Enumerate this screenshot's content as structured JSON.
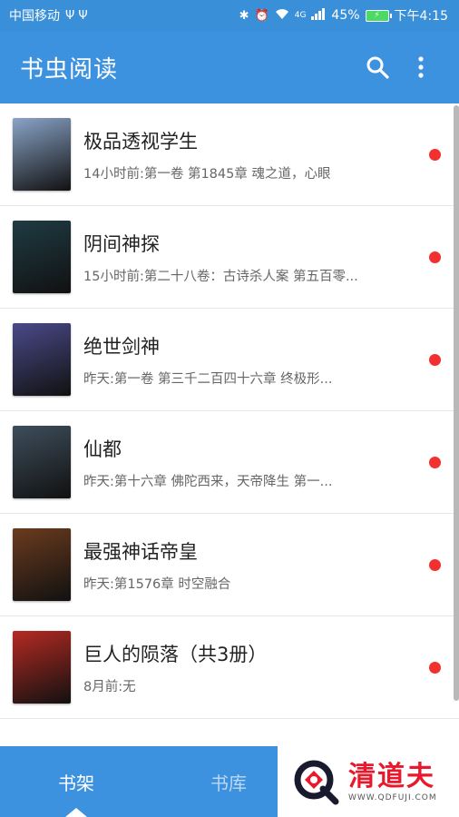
{
  "status_bar": {
    "carrier": "中国移动",
    "usb_icons": "Ψ Ψ",
    "network": "4G",
    "battery_percent": "45%",
    "time": "下午4:15"
  },
  "app_bar": {
    "title": "书虫阅读",
    "search_icon": "search-icon",
    "menu_icon": "more-vert-icon"
  },
  "books": [
    {
      "title": "极品透视学生",
      "latest": "14小时前:第一卷 第1845章 魂之道，心眼",
      "cover_color": "#8aa4c8",
      "unread": true
    },
    {
      "title": "阴间神探",
      "latest": "15小时前:第二十八卷：古诗杀人案 第五百零...",
      "cover_color": "#1f3b44",
      "unread": true
    },
    {
      "title": "绝世剑神",
      "latest": "昨天:第一卷 第三千二百四十六章 终极形...",
      "cover_color": "#4a4a8a",
      "unread": true
    },
    {
      "title": "仙都",
      "latest": "昨天:第十六章 佛陀西来，天帝降生 第一...",
      "cover_color": "#3e4e5c",
      "unread": true
    },
    {
      "title": "最强神话帝皇",
      "latest": "昨天:第1576章 时空融合",
      "cover_color": "#6b3b1e",
      "unread": true
    },
    {
      "title": "巨人的陨落（共3册）",
      "latest": "8月前:无",
      "cover_color": "#b52a22",
      "unread": true
    }
  ],
  "bottom_nav": {
    "tabs": [
      {
        "label": "书架",
        "active": true
      },
      {
        "label": "书库",
        "active": false
      }
    ]
  },
  "watermark": {
    "name": "清道夫",
    "url": "WWW.QDFUJI.COM"
  },
  "colors": {
    "primary": "#3d92df",
    "unread_dot": "#f23030"
  }
}
